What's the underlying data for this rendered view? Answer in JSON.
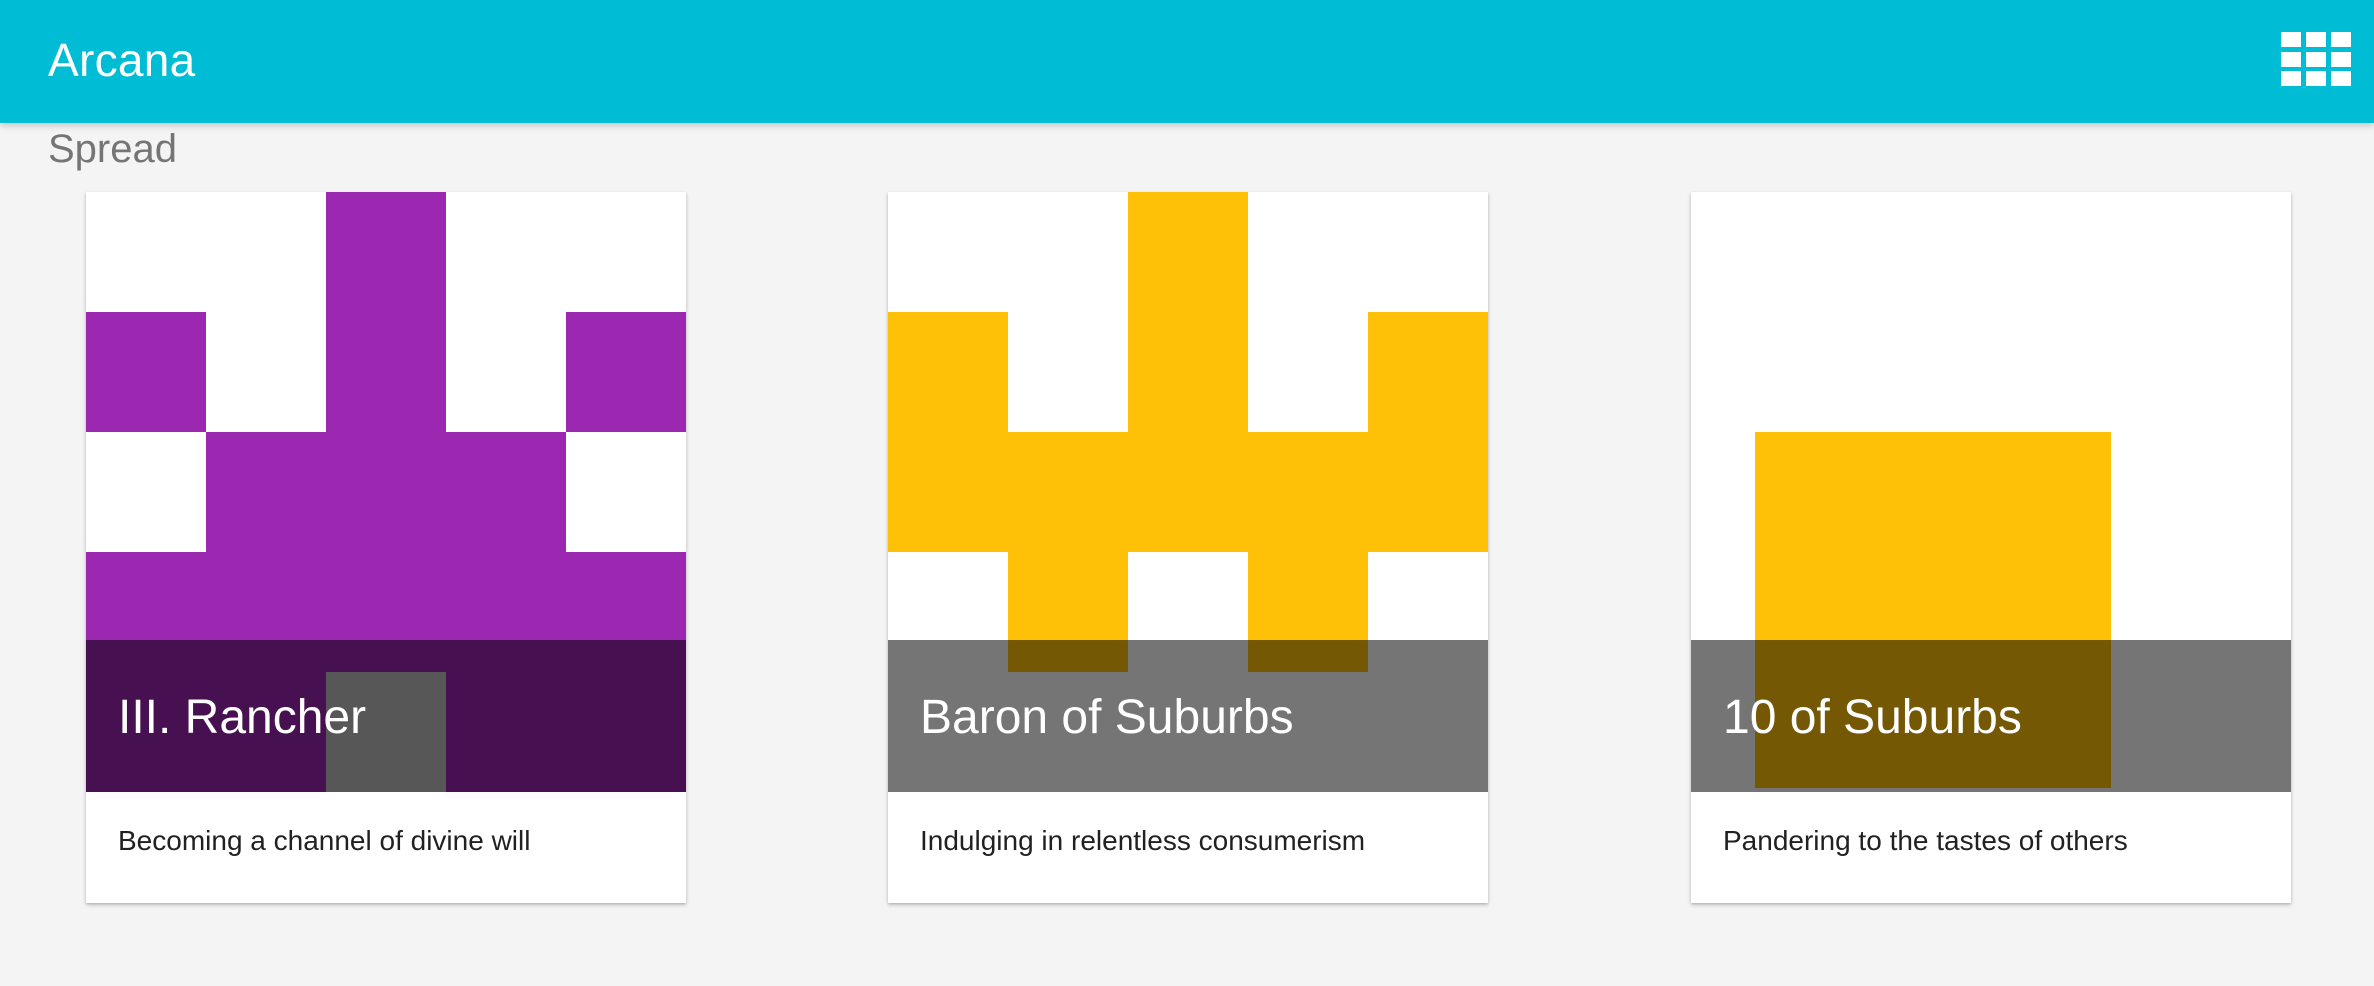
{
  "app": {
    "title": "Arcana",
    "apps_icon": "grid-icon"
  },
  "section": {
    "title": "Spread"
  },
  "colors": {
    "appbar": "#00bcd4",
    "purple": "#9c27b0",
    "amber": "#ffc107",
    "gray": "#757575"
  },
  "cards": [
    {
      "title": "III. Rancher",
      "description": "Becoming a channel of divine will",
      "art_icon": "crown-icon"
    },
    {
      "title": "Baron of Suburbs",
      "description": "Indulging in relentless consumerism",
      "art_icon": "castle-icon"
    },
    {
      "title": "10 of Suburbs",
      "description": "Pandering to the tastes of others",
      "art_icon": "block-icon"
    }
  ]
}
